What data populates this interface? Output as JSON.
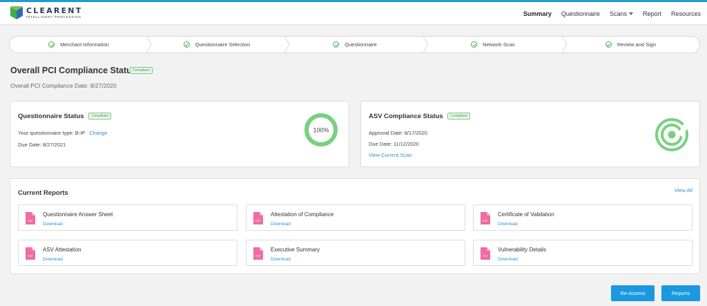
{
  "header": {
    "logo_word": "CLEARENT",
    "logo_tagline": "INTELLIGENT PROCESSING",
    "nav": [
      {
        "label": "Summary"
      },
      {
        "label": "Questionnaire"
      },
      {
        "label": "Scans"
      },
      {
        "label": "Report"
      },
      {
        "label": "Resources"
      }
    ]
  },
  "stepper": {
    "steps": [
      {
        "label": "Merchant Information"
      },
      {
        "label": "Questionnaire Selection"
      },
      {
        "label": "Questionnaire"
      },
      {
        "label": "Network Scan"
      },
      {
        "label": "Review and Sign"
      }
    ]
  },
  "overview": {
    "title": "Overall PCI Compliance Status",
    "badge": "Compliant",
    "date_text": "Overall PCI Compliance Date: 8/27/2020"
  },
  "questionnaire_card": {
    "title": "Questionnaire Status",
    "badge": "Compliant",
    "type_label": "Your questionnaire type: B-IP",
    "change_link": "Change",
    "due": "Due Date: 8/27/2021",
    "progress_label": "100%",
    "progress": 1.0
  },
  "asv_card": {
    "title": "ASV Compliance Status",
    "badge": "Compliant",
    "approval": "Approval Date: 8/17/2020",
    "due": "Due Date: 11/12/2020",
    "scan_link": "View Current Scan"
  },
  "reports": {
    "title": "Current Reports",
    "view_all": "View All",
    "items": [
      {
        "name": "Questionnaire Answer Sheet",
        "action": "Download"
      },
      {
        "name": "Attestation of Compliance",
        "action": "Download"
      },
      {
        "name": "Certificate of Validation",
        "action": "Download"
      },
      {
        "name": "ASV Attestation",
        "action": "Download"
      },
      {
        "name": "Executive Summary",
        "action": "Download"
      },
      {
        "name": "Vulnerability Details",
        "action": "Download"
      }
    ],
    "pdf_icon_text": "PDF"
  },
  "actions": {
    "reassess": "Re-Assess",
    "reports": "Reports"
  },
  "colors": {
    "accent": "#1a98e0",
    "success": "#77d17f",
    "pdf": "#f06ca3"
  }
}
